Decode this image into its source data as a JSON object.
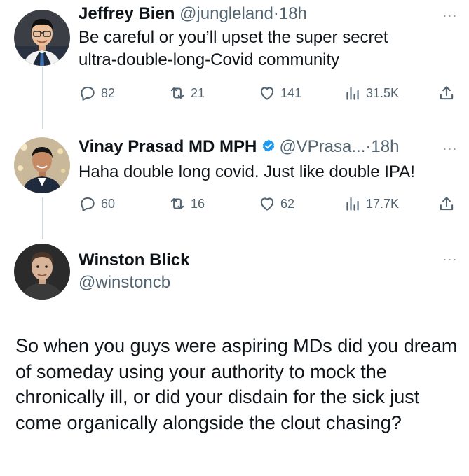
{
  "tweets": [
    {
      "name": "Jeffrey Bien",
      "handle": "@jungleland",
      "separator": "·",
      "time": "18h",
      "text": "Be careful or you’ll upset the super secret ultra-double-long-Covid community",
      "replies": "82",
      "retweets": "21",
      "likes": "141",
      "views": "31.5K",
      "verified": false
    },
    {
      "name": "Vinay Prasad MD MPH",
      "handle": "@VPrasa...",
      "separator": "·",
      "time": "18h",
      "text": "Haha double long covid. Just like double IPA!",
      "replies": "60",
      "retweets": "16",
      "likes": "62",
      "views": "17.7K",
      "verified": true
    }
  ],
  "main_tweet": {
    "name": "Winston Blick",
    "handle": "@winstoncb",
    "text": "So when you guys were aspiring MDs did you dream of someday using your authority to mock the chronically ill, or did your disdain for the sick just come  organically alongside the clout chasing?"
  },
  "more_label": "···",
  "colors": {
    "text": "#0f1419",
    "secondary": "#536471",
    "verified_blue": "#1d9bf0",
    "thread_line": "#cfd9de"
  },
  "icons": [
    "reply-icon",
    "retweet-icon",
    "like-icon",
    "views-icon",
    "share-icon",
    "verified-badge-icon",
    "more-icon"
  ]
}
